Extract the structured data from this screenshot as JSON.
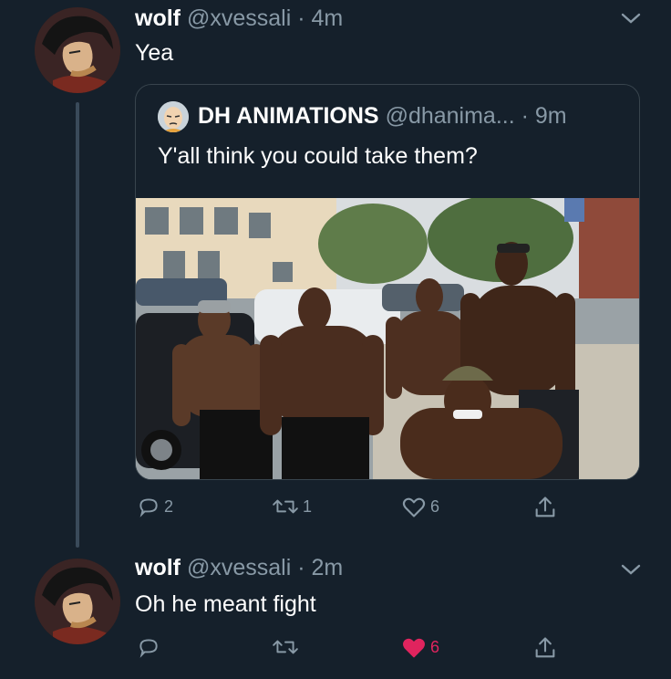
{
  "tweet1": {
    "name": "wolf",
    "handle": "@xvessali",
    "time": "· 4m",
    "text": "Yea",
    "avatar_icon": "anime-character-avatar",
    "quote": {
      "name": "DH ANIMATIONS",
      "handle": "@dhanima... ",
      "time": "· 9m",
      "text": "Y'all think you could take them?",
      "avatar_icon": "bald-cartoon-avatar",
      "photo_icon": "photo-five-muscular-men-street"
    },
    "actions": {
      "reply_count": "2",
      "retweet_count": "1",
      "like_count": "6"
    }
  },
  "tweet2": {
    "name": "wolf",
    "handle": "@xvessali",
    "time": "· 2m",
    "text": "Oh he meant fight",
    "avatar_icon": "anime-character-avatar",
    "actions": {
      "like_count": "6"
    }
  },
  "colors": {
    "background": "#15202b",
    "muted": "#8899a6",
    "border": "#38444d",
    "like_active": "#e0245e"
  }
}
